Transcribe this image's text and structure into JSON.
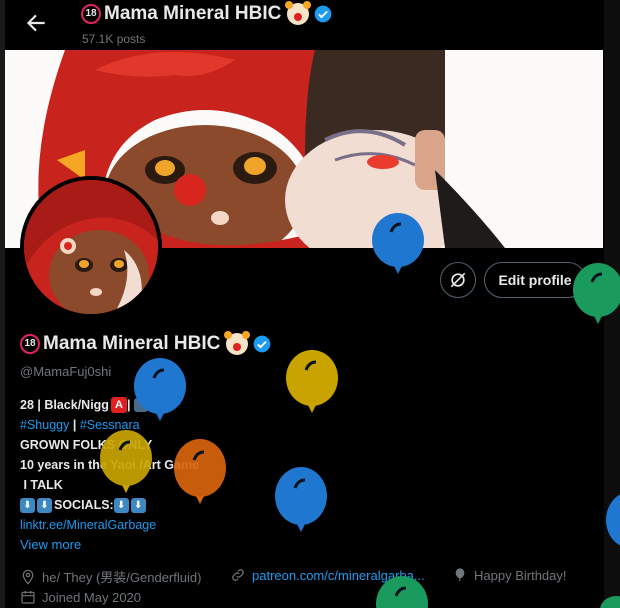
{
  "header": {
    "display_name": "Mama Mineral HBIC",
    "badge_text": "18",
    "posts_count": "57.1K posts"
  },
  "profile": {
    "display_name": "Mama Mineral HBIC",
    "badge_text": "18",
    "handle": "@MamaFuj0shi",
    "edit_profile_label": "Edit profile",
    "bio": {
      "line1_prefix": "28 | Black/Nigg",
      "line1_box": "A",
      "line1_suffix": " |",
      "line2_tag1": "#Shuggy",
      "line2_sep": " | ",
      "line2_tag2": "#Sessnara",
      "line3": "GROWN FOLKS ONLY",
      "line4": "10 years in the Yaoi /Art Game",
      "line5": " I TALK",
      "line6_label": "SOCIALS:",
      "line7_link": "linktr.ee/MineralGarbage"
    },
    "view_more": "View more",
    "meta": {
      "location": "he/ They (男装/Genderfluid)",
      "website": "patreon.com/c/mineralgarba...",
      "birthday": "Happy Birthday!",
      "joined": "Joined May 2020"
    }
  },
  "colors": {
    "accent": "#1d9bf0",
    "balloon_blue": "#1f77d0",
    "balloon_yellow": "#c9a400",
    "balloon_orange": "#d9640e",
    "balloon_green": "#1a9a5c"
  }
}
